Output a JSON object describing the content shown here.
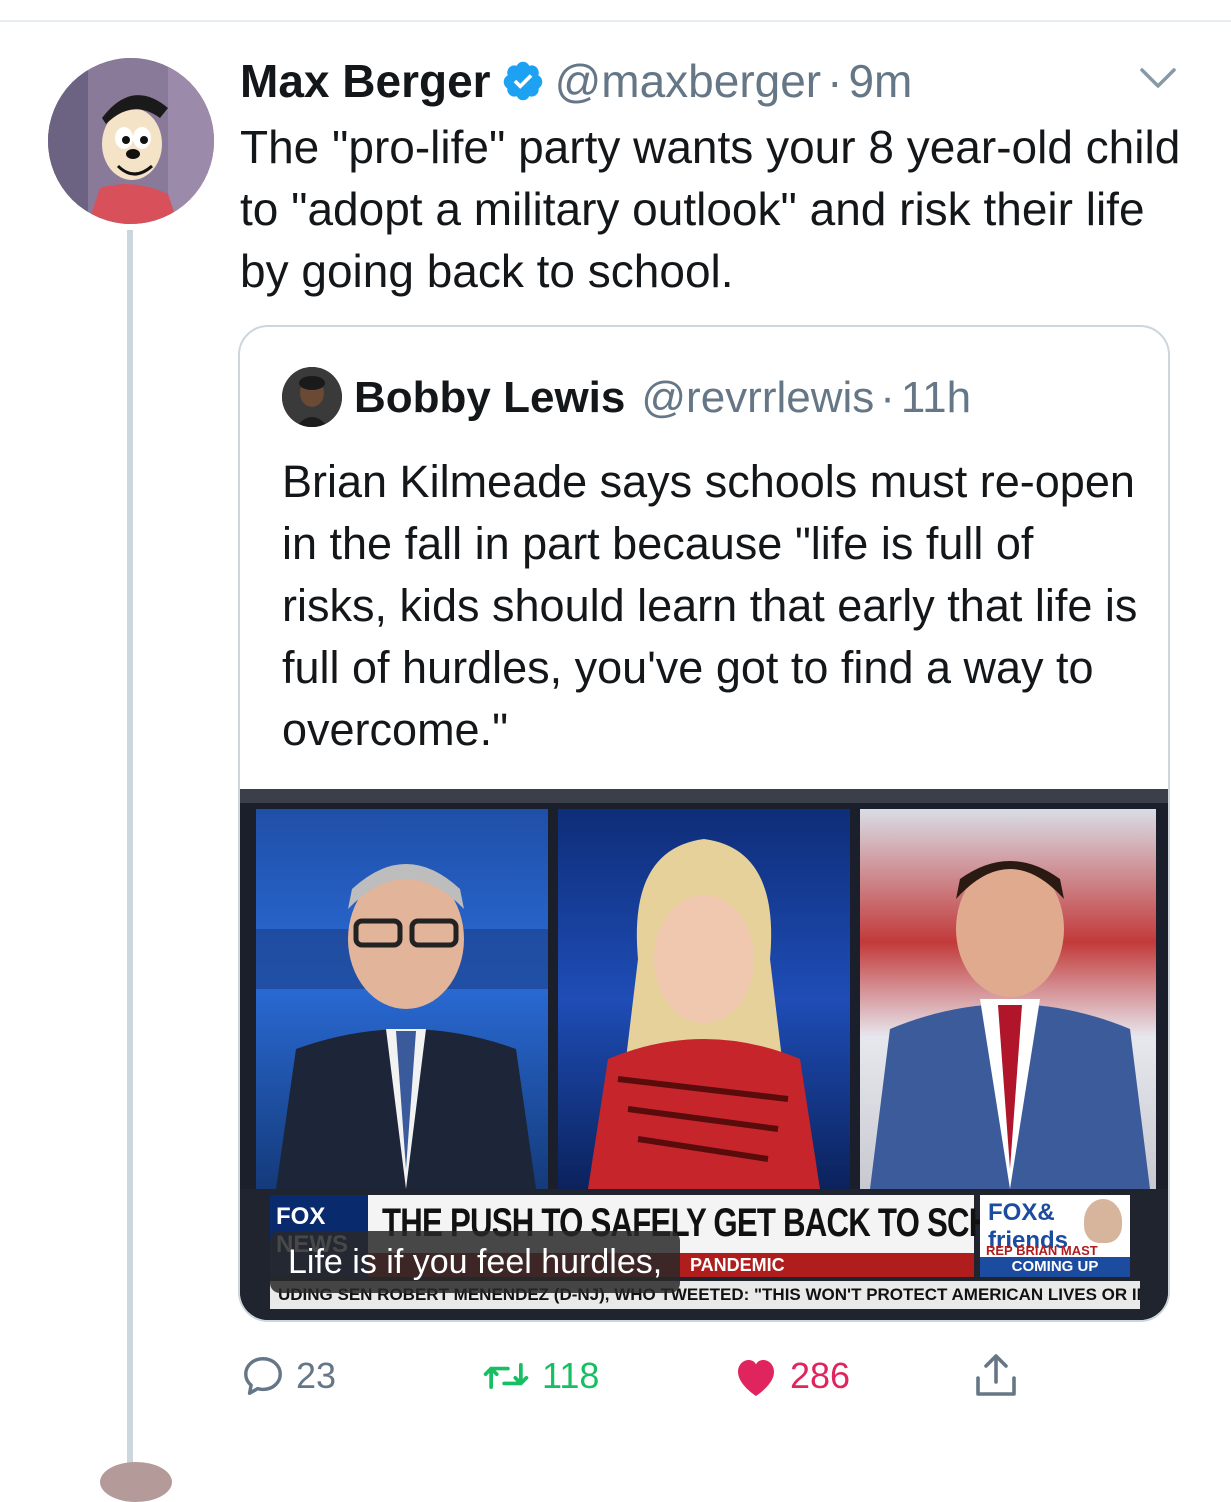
{
  "tweet": {
    "author_name": "Max Berger",
    "handle": "@maxberger",
    "separator": "·",
    "time": "9m",
    "text": "The \"pro-life\" party wants your 8 year-old child to \"adopt a military outlook\" and risk their life by going back to school.",
    "actions": {
      "reply_count": "23",
      "retweet_count": "118",
      "like_count": "286"
    }
  },
  "quoted_tweet": {
    "author_name": "Bobby Lewis",
    "handle": "@revrrlewis",
    "separator": "·",
    "time": "11h",
    "text": "Brian Kilmeade says schools must re-open in the fall in part because \"life is full of risks, kids should learn that early that life is full of hurdles, you've got to find a way to overcome.\"",
    "video": {
      "network_logo": "FOX NEWS",
      "headline": "THE PUSH TO SAFELY GET BACK TO SCHOOL",
      "subheadline": "PANDEMIC",
      "show_logo": "FOX& friends",
      "guest_label": "REP BRIAN MAST",
      "coming_up": "COMING UP",
      "ticker": "UDING SEN ROBERT MENENDEZ (D-NJ), WHO TWEETED: \"THIS WON'T PROTECT AMERICAN LIVES OR INTER",
      "caption": "Life is if you feel hurdles,"
    }
  },
  "colors": {
    "verified": "#1da1f2",
    "muted": "#657786",
    "retweet": "#17bf63",
    "like": "#e0245e",
    "border": "#ccd6dd"
  }
}
